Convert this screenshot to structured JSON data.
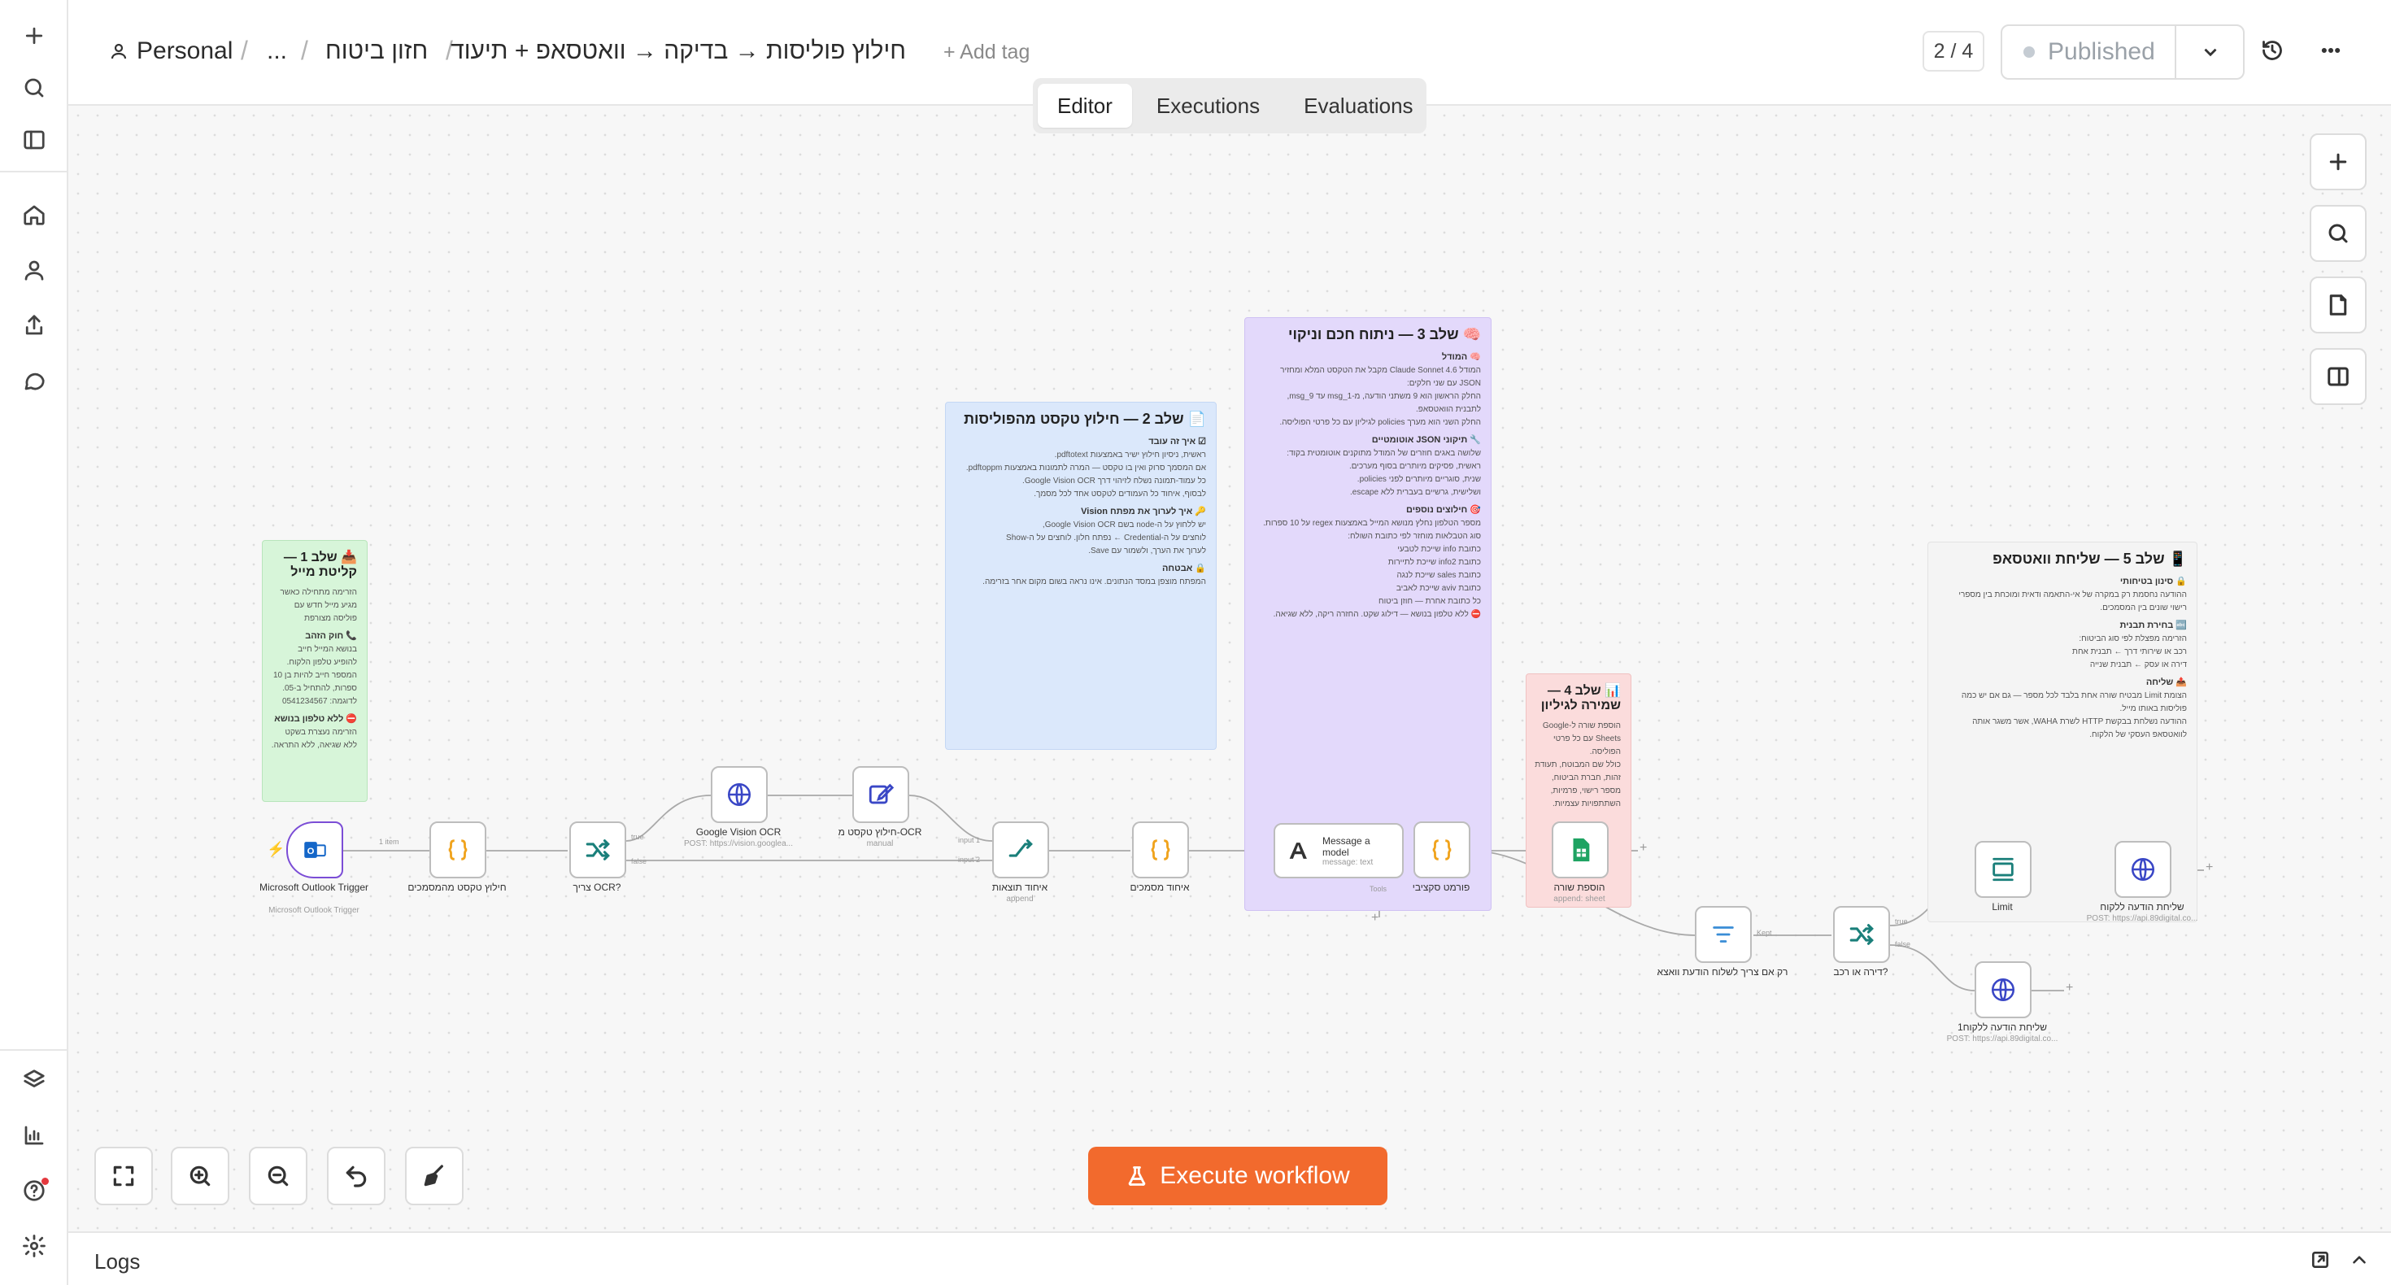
{
  "header": {
    "breadcrumb_owner": "Personal",
    "breadcrumb_ellipsis": "...",
    "breadcrumb_folder": "חזון ביטוח",
    "workflow_title": "חילוץ פוליסות → בדיקה → וואטסאפ + תיעוד",
    "add_tag": "+ Add tag",
    "version_counter": "2 / 4",
    "publish_label": "Published"
  },
  "tabs": [
    "Editor",
    "Executions",
    "Evaluations"
  ],
  "active_tab": "Editor",
  "execute_label": "Execute workflow",
  "logs_label": "Logs",
  "stickies": {
    "s1": {
      "title": "📥 שלב 1 — קליטת מייל",
      "lines": [
        "הזרימה מתחילה כאשר",
        "מגיע מייל חדש עם",
        "פוליסה מצורפת"
      ],
      "h1": "📞 חוק הזהב",
      "lines2": [
        "בנושא המייל חייב",
        "להופיע טלפון הלקוח.",
        "המספר חייב להיות בן 10",
        "ספרות, להתחיל ב-05.",
        "לדוגמה: 0541234567"
      ],
      "h2": "⛔ ללא טלפון בנושא",
      "lines3": [
        "הזרימה נעצרת בשקט",
        "ללא שגיאה, ללא התראה."
      ]
    },
    "s2": {
      "title": "📄 שלב 2 — חילוץ טקסט מהפוליסות",
      "h1": "☑ איך זה עובד",
      "lines": [
        "ראשית, ניסיון חילוץ ישיר באמצעות pdftotext.",
        "אם המסמך סרוק ואין בו טקסט — המרה לתמונות באמצעות pdftoppm.",
        "כל עמוד-תמונה נשלח לזיהוי דרך Google Vision OCR.",
        "לבסוף, איחוד כל העמודים לטקסט אחד לכל מסמך."
      ],
      "h2": "🔑 איך לערוך את מפתח Vision",
      "lines2": [
        "יש ללחוץ על ה-node בשם Google Vision OCR,",
        "לוחצים על ה-Credential ← נפתח חלון. לוחצים על ה-Show",
        "לערוך את הערך, ולשמור עם Save."
      ],
      "h3": "🔒 אבטחה",
      "lines3": [
        "המפתח מוצפן במסד הנתונים. אינו נראה בשום מקום אחר בזרימה."
      ]
    },
    "s3": {
      "title": "🧠 שלב 3 — ניתוח חכם וניקוי",
      "h1": "🧠 המודל",
      "lines": [
        "המודל Claude Sonnet 4.6 מקבל את הטקסט המלא ומחזיר",
        "JSON עם שני חלקים:",
        "החלק הראשון הוא 9 משתני הודעה, מ-msg_1 עד msg_9,",
        "לתבנית הוואטסאפ.",
        "החלק השני הוא מערך policies לגיליון עם כל פרטי הפוליסה."
      ],
      "h2": "🔧 תיקוני JSON אוטומטיים",
      "lines2": [
        "שלושה באגים חוזרים של המודל מתוקנים אוטומטית בקוד:",
        "ראשית, פסיקים מיותרים בסוף מערכים.",
        "שנית, סוגריים מיותרים לפני policies.",
        "ושלישית, גרשיים בעברית ללא escape."
      ],
      "h3": "🎯 חילוצים נוספים",
      "lines3": [
        "מספר הטלפון נחלץ מנושא המייל באמצעות regex על 10 ספרות.",
        "סוג הטבלאות מוחזר לפי כתובת השולח:"
      ],
      "bullets": [
        "כתובת info שייכת לטבעי",
        "כתובת info2 שייכת לתיירות",
        "כתובת sales שייכת לנגה",
        "כתובת aviv שייכת לאביב",
        "כל כתובת אחרת — חוזן ביטוח"
      ],
      "lines4": [
        "⛔ ללא טלפון בנושא — דילוג שקט. החזרה ריקה, ללא שגיאה."
      ]
    },
    "s4": {
      "title": "📊 שלב 4 — שמירה לגיליון",
      "lines": [
        "הוספת שורה ל-Google",
        "Sheets עם כל פרטי",
        "הפוליסה.",
        "כולל שם המבוטח, תעודת",
        "זהות, חברת הביטוח,",
        "מספר רישוי, פרמיות,",
        "השתתפויות עצמיות."
      ]
    },
    "s5": {
      "title": "📱 שלב 5 — שליחת וואטסאפ",
      "h1": "🔒 סינון בטיחותי",
      "lines": [
        "ההודעה נחסמת רק במקרה של אי-התאמה ודאית ומוכחת בין מספרי",
        "רישוי שונים בין המסמכים."
      ],
      "h2": "🔤 בחירת תבנית",
      "lines2": [
        "הזרימה מפצלת לפי סוג הביטוח:"
      ],
      "bullets": [
        "רכב או שירותי דרך ← תבנית אחת",
        "דירה או עסק ← תבנית שנייה"
      ],
      "h3": "📤 שליחה",
      "lines3": [
        "הצומת Limit מבטיח שורה אחת בלבד לכל מספר — גם אם יש כמה",
        "פוליסות באותו מייל.",
        "ההודעה נשלחת בבקשת HTTP לשרת WAHA, אשר משגר אותה",
        "לוואטסאפ העסקי של הלקוח."
      ]
    }
  },
  "nodes": {
    "trigger": {
      "label": "Microsoft Outlook Trigger",
      "sub": "Microsoft Outlook Trigger"
    },
    "extract_attachments": {
      "label": "חילוץ טקסט מהמסמכים"
    },
    "needs_ocr": {
      "label": "צריך OCR?"
    },
    "vision_ocr": {
      "label": "Google Vision OCR",
      "sub": "POST: https://vision.googlea..."
    },
    "ocr_text": {
      "label": "חילוץ טקסט מ-OCR",
      "sub": "manual"
    },
    "merge_results": {
      "label": "איחוד תוצאות",
      "sub": "append"
    },
    "merge_docs": {
      "label": "איחוד מסמכים"
    },
    "message_model": {
      "title": "Message a",
      "title2": "model",
      "sub": "message: text"
    },
    "format_fields": {
      "label": "פורמט סקציבי"
    },
    "append_row": {
      "label": "הוספת שורה",
      "sub": "append: sheet"
    },
    "filter": {
      "label": "רק אם צריך לשלוח הודעת וואצא"
    },
    "switch_type": {
      "label": "דירה או רכב?"
    },
    "limit": {
      "label": "Limit"
    },
    "send_msg_1": {
      "label": "שליחת הודעה ללקוח",
      "sub": "POST: https://api.89digital.co..."
    },
    "send_msg_2": {
      "label": "שליחת הודעה ללקוח1",
      "sub": "POST: https://api.89digital.co..."
    }
  },
  "edge_labels": {
    "items": "1 item",
    "true": "true",
    "false": "false",
    "input1": "input 1",
    "input2": "input 2",
    "tools": "Tools",
    "kept": "Kept"
  },
  "colors": {
    "accent": "#f26a2d",
    "trigger_border": "#7b4dd6",
    "code_icon": "#f0a31c",
    "switch_icon": "#1a7f7a",
    "http_icon": "#3a47c6",
    "sheets_icon": "#1ea362"
  }
}
